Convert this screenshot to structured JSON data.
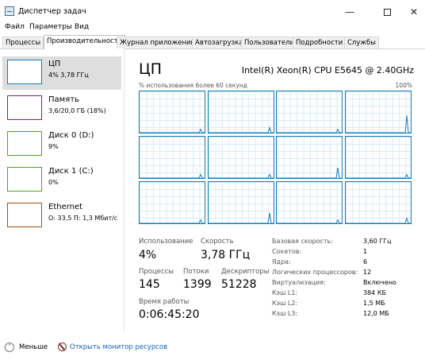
{
  "window": {
    "title": "Диспетчер задач",
    "minimize": "—",
    "close": "✕"
  },
  "menu": [
    "Файл",
    "Параметры",
    "Вид"
  ],
  "tabs": [
    "Процессы",
    "Производительность",
    "Журнал приложений",
    "Автозагрузка",
    "Пользователи",
    "Подробности",
    "Службы"
  ],
  "active_tab": "Производительность",
  "sidebar": [
    {
      "title": "ЦП",
      "sub": "4% 3,78 ГГц",
      "color": "#117dbb",
      "selected": true
    },
    {
      "title": "Память",
      "sub": "3,6/20,0 ГБ (18%)",
      "color": "#8b12ae"
    },
    {
      "title": "Диск 0 (D:)",
      "sub": "9%",
      "color": "#4da60c"
    },
    {
      "title": "Диск 1 (C:)",
      "sub": "0%",
      "color": "#4da60c"
    },
    {
      "title": "Ethernet",
      "sub": "О: 33,5 П: 1,3 Мбит/с",
      "color": "#a74f01"
    }
  ],
  "cpu": {
    "title": "ЦП",
    "model": "Intel(R) Xeon(R) CPU E5645 @ 2.40GHz",
    "graph_label": "% использования 6олее 60 секунд",
    "graph_max": "100%",
    "core_spikes_percent": [
      2,
      3,
      2,
      10,
      2,
      2,
      6,
      2,
      2,
      6,
      2,
      3
    ]
  },
  "stats": {
    "utilization_label": "Использование",
    "utilization": "4%",
    "speed_label": "Скорость",
    "speed": "3,78 ГГц",
    "processes_label": "Процессы",
    "processes": "145",
    "threads_label": "Потоки",
    "threads": "1399",
    "handles_label": "Дескрипторы",
    "handles": "51228",
    "uptime_label": "Время работы",
    "uptime": "0:06:45:20"
  },
  "info": [
    {
      "key": "Базовая скорость:",
      "value": "3,60 ГГц"
    },
    {
      "key": "Сокетов:",
      "value": "1"
    },
    {
      "key": "Ядра:",
      "value": "6"
    },
    {
      "key": "Логических процессоров:",
      "value": "12"
    },
    {
      "key": "Виртуализация:",
      "value": "Включено"
    },
    {
      "key": "Кэш L1:",
      "value": "384 КБ"
    },
    {
      "key": "Кэш L2:",
      "value": "1,5 МБ"
    },
    {
      "key": "Кэш L3:",
      "value": "12,0 МБ"
    }
  ],
  "footer": {
    "less": "Меньше",
    "monitor": "Открыть монитор ресурсов"
  }
}
